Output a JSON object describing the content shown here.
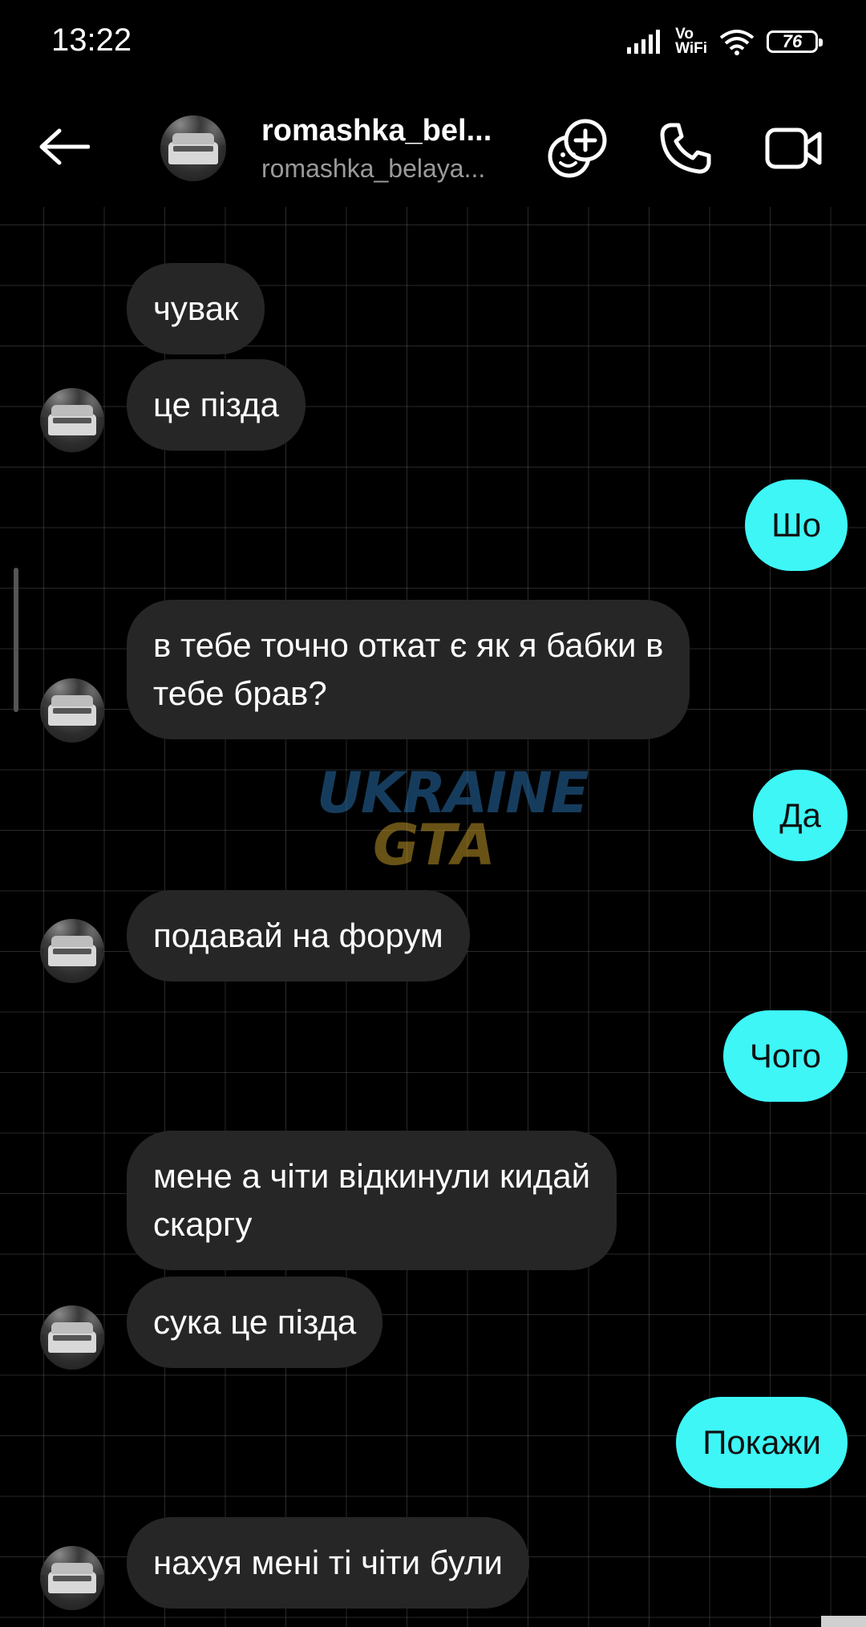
{
  "status_bar": {
    "time": "13:22",
    "vowifi_top": "Vo",
    "vowifi_bottom": "WiFi",
    "battery": "76"
  },
  "header": {
    "contact_name": "romashka_bel...",
    "contact_username": "romashka_belaya...",
    "icons": [
      "back-arrow-icon",
      "add-effects-icon",
      "phone-icon",
      "video-camera-icon"
    ]
  },
  "watermark": {
    "line1": "UKRAINE",
    "line2": "GTA"
  },
  "messages": [
    {
      "side": "in",
      "text": "чувак"
    },
    {
      "side": "in",
      "text": "це пізда"
    },
    {
      "side": "out",
      "text": "Шо"
    },
    {
      "side": "in",
      "text": "в тебе точно откат є як я бабки в\nтебе брав?"
    },
    {
      "side": "out",
      "text": "Да"
    },
    {
      "side": "in",
      "text": "подавай на форум"
    },
    {
      "side": "out",
      "text": "Чого"
    },
    {
      "side": "in",
      "text": "мене а чіти відкинули кидай\nскаргу"
    },
    {
      "side": "in",
      "text": "сука це пізда"
    },
    {
      "side": "out",
      "text": "Покажи"
    },
    {
      "side": "in",
      "text": "нахуя мені ті чіти були"
    }
  ],
  "colors": {
    "background": "#000000",
    "incoming_bubble": "#262626",
    "outgoing_bubble": "#3ef6f6"
  }
}
